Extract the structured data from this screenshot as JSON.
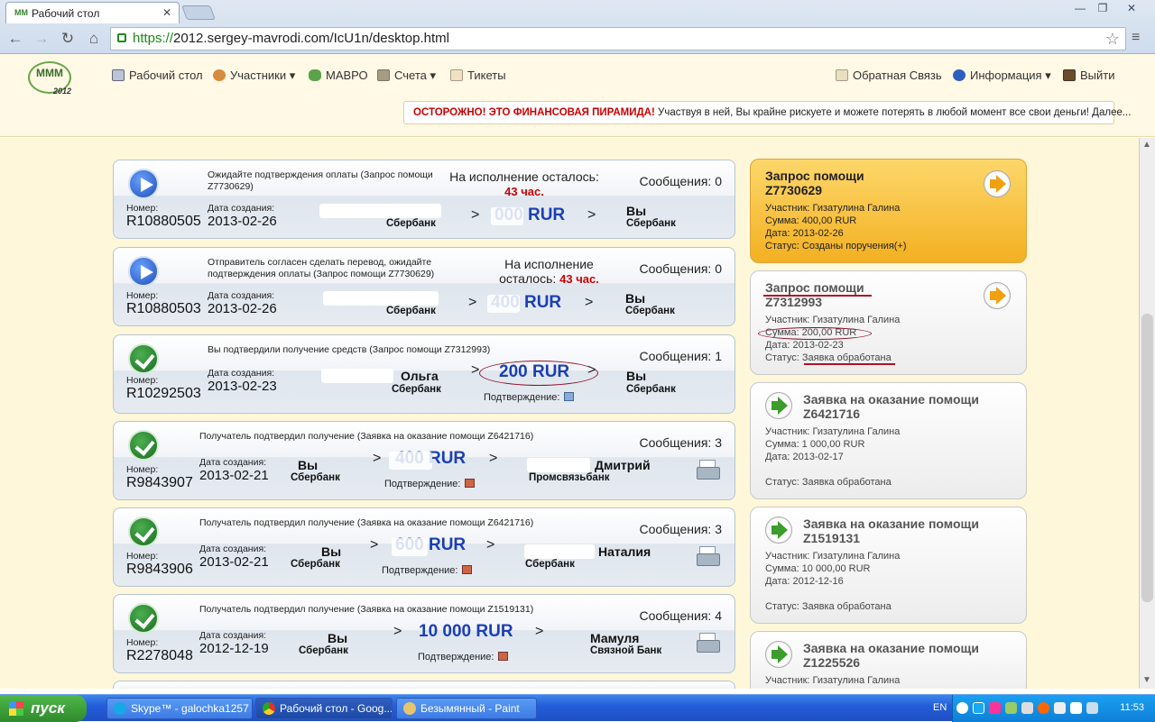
{
  "browser": {
    "tab_title": "Рабочий стол",
    "url_scheme": "https://",
    "url_rest": "2012.sergey-mavrodi.com/IcU1n/desktop.html"
  },
  "site": {
    "logo_text": "MMM",
    "logo_year": "2012",
    "menu": {
      "desktop": "Рабочий стол",
      "participants": "Участники",
      "mavro": "МАВРО",
      "accounts": "Счета",
      "tickets": "Тикеты",
      "feedback": "Обратная Связь",
      "info": "Информация",
      "logout": "Выйти"
    },
    "warning_bold": "ОСТОРОЖНО! ЭТО ФИНАНСОВАЯ ПИРАМИДА!",
    "warning_text": " Участвуя в ней, Вы крайне рискуете и можете потерять в любой момент все свои деньги! Далее..."
  },
  "cards": [
    {
      "desc": "Ожидайте подтверждения оплаты (Запрос помощи Z7730629)",
      "remain_label": "На исполнение осталось:",
      "remain_value": "43 час.",
      "messages": "Сообщения: 0",
      "number_label": "Номер:",
      "number": "R10880505",
      "date_label": "Дата создания:",
      "date": "2013-02-26",
      "from_bank": "Сбербанк",
      "amount": "000 RUR",
      "to_name": "Вы",
      "to_bank": "Сбербанк"
    },
    {
      "desc": "Отправитель согласен сделать перевод, ожидайте подтверждения оплаты (Запрос помощи Z7730629)",
      "remain_label1": "На исполнение",
      "remain_label2": "осталось:",
      "remain_value": "43 час.",
      "messages": "Сообщения: 0",
      "number_label": "Номер:",
      "number": "R10880503",
      "date_label": "Дата создания:",
      "date": "2013-02-26",
      "from_bank": "Сбербанк",
      "amount": "400 RUR",
      "to_name": "Вы",
      "to_bank": "Сбербанк"
    },
    {
      "desc": "Вы подтвердили получение средств (Запрос помощи Z7312993)",
      "messages": "Сообщения: 1",
      "number_label": "Номер:",
      "number": "R10292503",
      "date_label": "Дата создания:",
      "date": "2013-02-23",
      "from_name": "Ольга",
      "from_bank": "Сбербанк",
      "amount": "200 RUR",
      "confirm": "Подтверждение:",
      "to_name": "Вы",
      "to_bank": "Сбербанк"
    },
    {
      "desc": "Получатель подтвердил получение (Заявка на оказание помощи Z6421716)",
      "messages": "Сообщения: 3",
      "number_label": "Номер:",
      "number": "R9843907",
      "date_label": "Дата создания:",
      "date": "2013-02-21",
      "from_name": "Вы",
      "from_bank": "Сбербанк",
      "amount": "400 RUR",
      "confirm": "Подтверждение:",
      "to_name": "Дмитрий",
      "to_bank": "Промсвязьбанк"
    },
    {
      "desc": "Получатель подтвердил получение (Заявка на оказание помощи Z6421716)",
      "messages": "Сообщения: 3",
      "number_label": "Номер:",
      "number": "R9843906",
      "date_label": "Дата создания:",
      "date": "2013-02-21",
      "from_name": "Вы",
      "from_bank": "Сбербанк",
      "amount": "600 RUR",
      "confirm": "Подтверждение:",
      "to_name": "Наталия",
      "to_bank": "Сбербанк"
    },
    {
      "desc": "Получатель подтвердил получение (Заявка на оказание помощи Z1519131)",
      "messages": "Сообщения: 4",
      "number_label": "Номер:",
      "number": "R2278048",
      "date_label": "Дата создания:",
      "date": "2012-12-19",
      "from_name": "Вы",
      "from_bank": "Сбербанк",
      "amount": "10 000 RUR",
      "confirm": "Подтверждение:",
      "to_name": "Мамуля",
      "to_bank": "Связной Банк"
    }
  ],
  "sidebar": [
    {
      "title": "Запрос помощи",
      "code": "Z7730629",
      "participant": "Участник: Гизатулина Галина",
      "sum": "Сумма: 400,00 RUR",
      "date": "Дата: 2013-02-26",
      "status": "Статус: Созданы поручения(+)"
    },
    {
      "title": "Запрос помощи",
      "code": "Z7312993",
      "participant": "Участник: Гизатулина Галина",
      "sum": "Сумма: 200,00 RUR",
      "date": "Дата: 2013-02-23",
      "status_label": "Статус: ",
      "status_value": "Заявка обработана"
    },
    {
      "title": "Заявка на оказание помощи",
      "code": "Z6421716",
      "participant": "Участник: Гизатулина Галина",
      "sum": "Сумма: 1 000,00 RUR",
      "date": "Дата: 2013-02-17",
      "status": "Статус: Заявка обработана"
    },
    {
      "title": "Заявка на оказание помощи",
      "code": "Z1519131",
      "participant": "Участник: Гизатулина Галина",
      "sum": "Сумма: 10 000,00 RUR",
      "date": "Дата: 2012-12-16",
      "status": "Статус: Заявка обработана"
    },
    {
      "title": "Заявка на оказание помощи",
      "code": "Z1225526",
      "participant": "Участник: Гизатулина Галина"
    }
  ],
  "taskbar": {
    "start": "пуск",
    "items": [
      "Skype™ - galochka1257",
      "Рабочий стол - Goog...",
      "Безымянный - Paint"
    ],
    "lang": "EN",
    "clock": "11:53"
  }
}
